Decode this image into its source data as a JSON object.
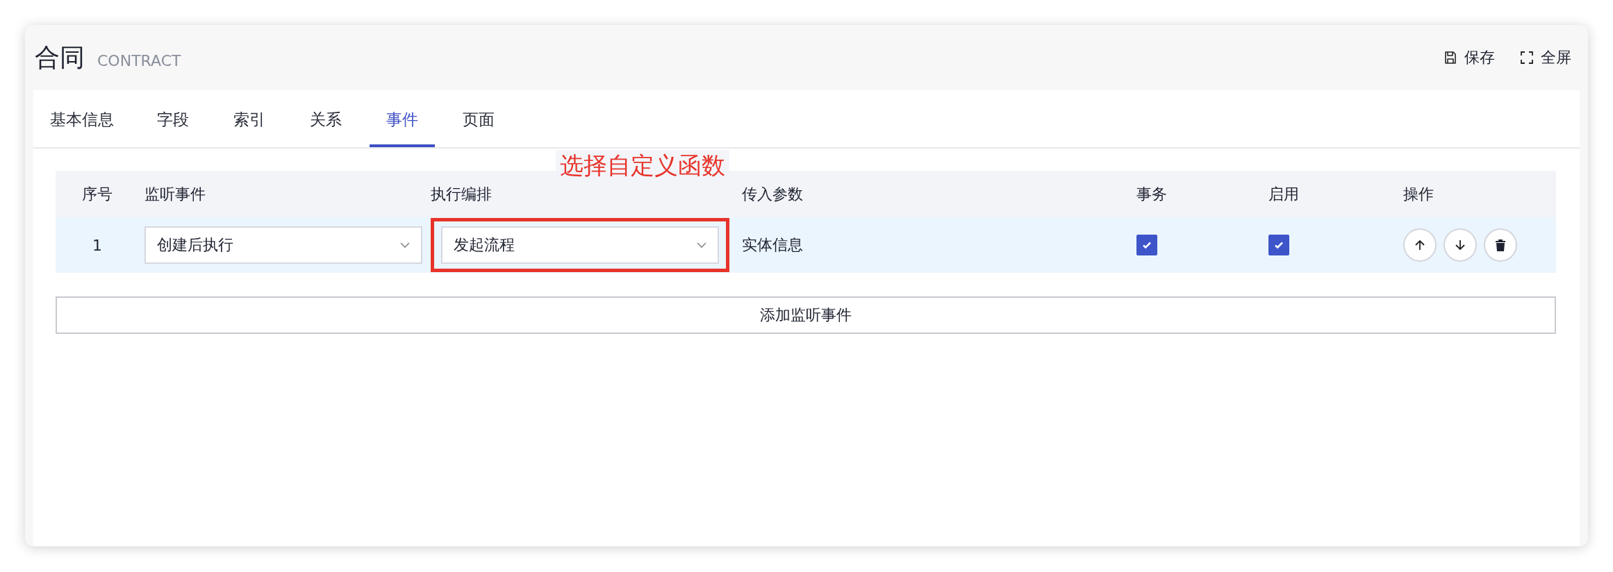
{
  "window": {
    "title": "合同",
    "subtitle": "CONTRACT"
  },
  "toolbar": [
    {
      "kind": "save",
      "label": "保存"
    },
    {
      "kind": "fullscreen",
      "label": "全屏"
    }
  ],
  "tabs": [
    {
      "label": "基本信息",
      "selected": false
    },
    {
      "label": "字段",
      "selected": false
    },
    {
      "label": "索引",
      "selected": false
    },
    {
      "label": "关系",
      "selected": false
    },
    {
      "label": "事件",
      "selected": true
    },
    {
      "label": "页面",
      "selected": false
    }
  ],
  "annotation": {
    "text": "选择自定义函数"
  },
  "table": {
    "columns": [
      "序号",
      "监听事件",
      "执行编排",
      "传入参数",
      "事务",
      "启用",
      "操作"
    ],
    "rows": [
      {
        "index": "1",
        "event": "创建后执行",
        "action": "发起流程",
        "params": "实体信息",
        "transaction": true,
        "enabled": true,
        "highlighted": true
      }
    ]
  },
  "add_button": "添加监听事件"
}
